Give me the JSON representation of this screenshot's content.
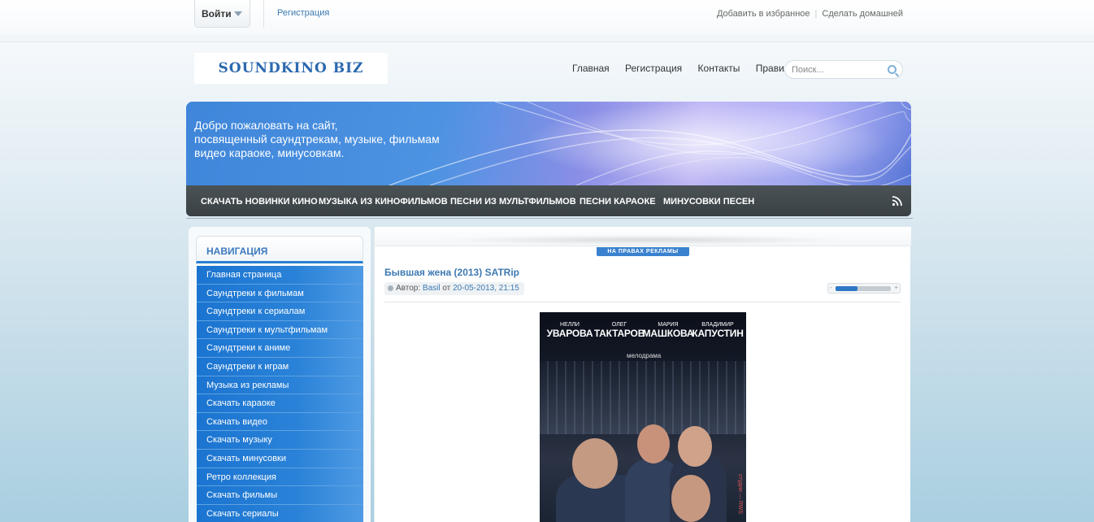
{
  "topbar": {
    "login_label": "Войти",
    "register_link": "Регистрация",
    "add_favorites": "Добавить в избранное",
    "make_home": "Сделать домашней"
  },
  "header": {
    "logo_text": "SOUNDKINO BIZ",
    "nav": [
      "Главная",
      "Регистрация",
      "Контакты",
      "Правила"
    ],
    "search_placeholder": "Поиск..."
  },
  "banner": {
    "lines": [
      "Добро пожаловать на сайт,",
      "посвященный саундтрекам, музыке, фильмам",
      "видео караоке, минусовкам."
    ]
  },
  "category_nav": [
    "СКАЧАТЬ НОВИНКИ КИНО",
    "МУЗЫКА ИЗ КИНОФИЛЬМОВ",
    "ПЕСНИ ИЗ МУЛЬТФИЛЬМОВ",
    "ПЕСНИ КАРАОКЕ",
    "МИНУСОВКИ ПЕСЕН"
  ],
  "sidebar": {
    "title": "НАВИГАЦИЯ",
    "items": [
      "Главная страница",
      "Саундтреки к фильмам",
      "Саундтреки к сериалам",
      "Саундтреки к мультфильмам",
      "Саундтреки к аниме",
      "Саундтреки к играм",
      "Музыка из рекламы",
      "Скачать караоке",
      "Скачать видео",
      "Скачать музыку",
      "Скачать минусовки",
      "Ретро коллекция",
      "Скачать фильмы",
      "Скачать сериалы"
    ]
  },
  "post": {
    "ad_label": "НА ПРАВАХ РЕКЛАМЫ",
    "title": "Бывшая жена (2013) SATRip",
    "author_label": "Автор:",
    "author": "Basil",
    "date_prefix": "от",
    "date": "20-05-2013, 21:15",
    "rating_minus": "-",
    "rating_plus": "+",
    "rating_fraction": 0.4
  },
  "poster": {
    "actors": [
      {
        "first": "НЕЛЛИ",
        "last": "УВАРОВА"
      },
      {
        "first": "ОЛЕГ",
        "last": "ТАКТАРОВ"
      },
      {
        "first": "МАРИЯ",
        "last": "МАШКОВА"
      },
      {
        "first": "ВЛАДИМИР",
        "last": "КАПУСТИН"
      }
    ],
    "genre": "мелодрама",
    "watermark": "studio",
    "studio_text": "студии — RWS"
  },
  "colors": {
    "accent": "#2a7fd0",
    "link": "#3d79b2",
    "nav_bar": "#41494d"
  },
  "icons": [
    "triangle-down-icon",
    "search-icon",
    "rss-icon",
    "bullet-icon"
  ]
}
